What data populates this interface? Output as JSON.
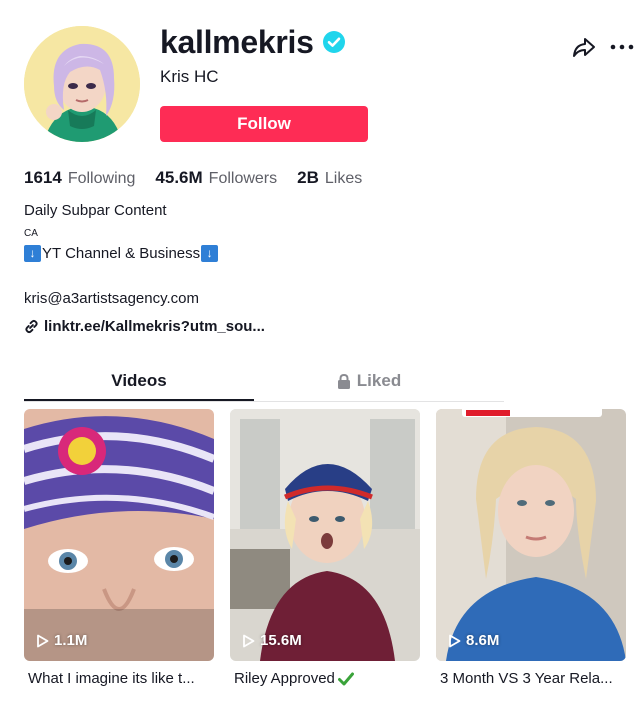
{
  "profile": {
    "username": "kallmekris",
    "nickname": "Kris HC",
    "follow_label": "Follow",
    "verified": true
  },
  "stats": {
    "following": {
      "value": "1614",
      "label": "Following"
    },
    "followers": {
      "value": "45.6M",
      "label": "Followers"
    },
    "likes": {
      "value": "2B",
      "label": "Likes"
    }
  },
  "bio": {
    "line1": "Daily Subpar Content",
    "line2": "CA",
    "line3_text": "YT Channel & Business",
    "line3_arrow": "↓",
    "email": "kris@a3artistsagency.com",
    "link": "linktr.ee/Kallmekris?utm_sou..."
  },
  "tabs": {
    "videos": "Videos",
    "liked": "Liked"
  },
  "videos": [
    {
      "views": "1.1M",
      "caption": "What I imagine its like t..."
    },
    {
      "views": "15.6M",
      "caption": "Riley Approved"
    },
    {
      "views": "8.6M",
      "caption": "3 Month VS 3 Year Rela..."
    }
  ],
  "colors": {
    "accent": "#fe2c55",
    "verified": "#20d5ec",
    "text": "#161823",
    "muted": "#5e5f67"
  }
}
